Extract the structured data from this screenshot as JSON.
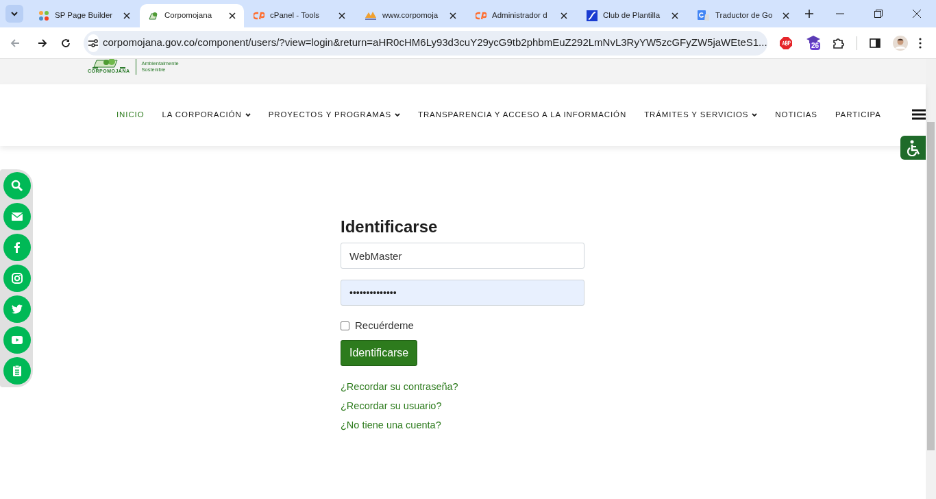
{
  "browser": {
    "tabs": [
      {
        "title": "SP Page Builder",
        "kind": "joomla",
        "selected": false
      },
      {
        "title": "Corpomojana",
        "kind": "site",
        "selected": true
      },
      {
        "title": "cPanel - Tools",
        "kind": "cpanel",
        "selected": false
      },
      {
        "title": "www.corpomoja",
        "kind": "pma",
        "selected": false
      },
      {
        "title": "Administrador d",
        "kind": "cpanel",
        "selected": false
      },
      {
        "title": "Club de Plantilla",
        "kind": "club",
        "selected": false
      },
      {
        "title": "Traductor de Go",
        "kind": "translate",
        "selected": false
      }
    ],
    "url": "corpomojana.gov.co/component/users/?view=login&return=aHR0cHM6Ly93d3cuY29ycG9tb2phbmEuZ292LmNvL3RyYW5zcGFyZW5jaWEteS1...",
    "extension_badge": "26"
  },
  "header": {
    "logo_text": "CORPOMOJANA",
    "tagline": [
      "Ambientalmente",
      "Sostenible"
    ]
  },
  "nav": [
    {
      "label": "INICIO",
      "selected": true,
      "dropdown": false
    },
    {
      "label": "LA CORPORACIÓN",
      "selected": false,
      "dropdown": true
    },
    {
      "label": "PROYECTOS Y PROGRAMAS",
      "selected": false,
      "dropdown": true
    },
    {
      "label": "TRANSPARENCIA Y ACCESO A LA INFORMACIÓN",
      "selected": false,
      "dropdown": false
    },
    {
      "label": "TRÁMITES Y SERVICIOS",
      "selected": false,
      "dropdown": true
    },
    {
      "label": "NOTICIAS",
      "selected": false,
      "dropdown": false
    },
    {
      "label": "PARTICIPA",
      "selected": false,
      "dropdown": false
    }
  ],
  "social": [
    {
      "kind": "search"
    },
    {
      "kind": "mail"
    },
    {
      "kind": "facebook"
    },
    {
      "kind": "instagram"
    },
    {
      "kind": "twitter"
    },
    {
      "kind": "youtube"
    },
    {
      "kind": "clipboard"
    }
  ],
  "login": {
    "title": "Identificarse",
    "username": "WebMaster",
    "password": "••••••••••••••",
    "remember": {
      "label": "Recuérdeme",
      "checked": false
    },
    "submit": "Identificarse",
    "links": [
      "¿Recordar su contraseña?",
      "¿Recordar su usuario?",
      "¿No tiene una cuenta?"
    ]
  }
}
